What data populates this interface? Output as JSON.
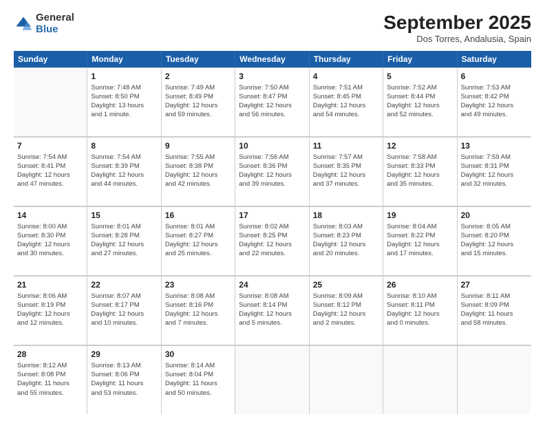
{
  "header": {
    "logo": {
      "general": "General",
      "blue": "Blue"
    },
    "title": "September 2025",
    "subtitle": "Dos Torres, Andalusia, Spain"
  },
  "weekdays": [
    "Sunday",
    "Monday",
    "Tuesday",
    "Wednesday",
    "Thursday",
    "Friday",
    "Saturday"
  ],
  "weeks": [
    [
      {
        "day": "",
        "info": ""
      },
      {
        "day": "1",
        "info": "Sunrise: 7:48 AM\nSunset: 8:50 PM\nDaylight: 13 hours\nand 1 minute."
      },
      {
        "day": "2",
        "info": "Sunrise: 7:49 AM\nSunset: 8:49 PM\nDaylight: 12 hours\nand 59 minutes."
      },
      {
        "day": "3",
        "info": "Sunrise: 7:50 AM\nSunset: 8:47 PM\nDaylight: 12 hours\nand 56 minutes."
      },
      {
        "day": "4",
        "info": "Sunrise: 7:51 AM\nSunset: 8:45 PM\nDaylight: 12 hours\nand 54 minutes."
      },
      {
        "day": "5",
        "info": "Sunrise: 7:52 AM\nSunset: 8:44 PM\nDaylight: 12 hours\nand 52 minutes."
      },
      {
        "day": "6",
        "info": "Sunrise: 7:53 AM\nSunset: 8:42 PM\nDaylight: 12 hours\nand 49 minutes."
      }
    ],
    [
      {
        "day": "7",
        "info": "Sunrise: 7:54 AM\nSunset: 8:41 PM\nDaylight: 12 hours\nand 47 minutes."
      },
      {
        "day": "8",
        "info": "Sunrise: 7:54 AM\nSunset: 8:39 PM\nDaylight: 12 hours\nand 44 minutes."
      },
      {
        "day": "9",
        "info": "Sunrise: 7:55 AM\nSunset: 8:38 PM\nDaylight: 12 hours\nand 42 minutes."
      },
      {
        "day": "10",
        "info": "Sunrise: 7:56 AM\nSunset: 8:36 PM\nDaylight: 12 hours\nand 39 minutes."
      },
      {
        "day": "11",
        "info": "Sunrise: 7:57 AM\nSunset: 8:35 PM\nDaylight: 12 hours\nand 37 minutes."
      },
      {
        "day": "12",
        "info": "Sunrise: 7:58 AM\nSunset: 8:33 PM\nDaylight: 12 hours\nand 35 minutes."
      },
      {
        "day": "13",
        "info": "Sunrise: 7:59 AM\nSunset: 8:31 PM\nDaylight: 12 hours\nand 32 minutes."
      }
    ],
    [
      {
        "day": "14",
        "info": "Sunrise: 8:00 AM\nSunset: 8:30 PM\nDaylight: 12 hours\nand 30 minutes."
      },
      {
        "day": "15",
        "info": "Sunrise: 8:01 AM\nSunset: 8:28 PM\nDaylight: 12 hours\nand 27 minutes."
      },
      {
        "day": "16",
        "info": "Sunrise: 8:01 AM\nSunset: 8:27 PM\nDaylight: 12 hours\nand 25 minutes."
      },
      {
        "day": "17",
        "info": "Sunrise: 8:02 AM\nSunset: 8:25 PM\nDaylight: 12 hours\nand 22 minutes."
      },
      {
        "day": "18",
        "info": "Sunrise: 8:03 AM\nSunset: 8:23 PM\nDaylight: 12 hours\nand 20 minutes."
      },
      {
        "day": "19",
        "info": "Sunrise: 8:04 AM\nSunset: 8:22 PM\nDaylight: 12 hours\nand 17 minutes."
      },
      {
        "day": "20",
        "info": "Sunrise: 8:05 AM\nSunset: 8:20 PM\nDaylight: 12 hours\nand 15 minutes."
      }
    ],
    [
      {
        "day": "21",
        "info": "Sunrise: 8:06 AM\nSunset: 8:19 PM\nDaylight: 12 hours\nand 12 minutes."
      },
      {
        "day": "22",
        "info": "Sunrise: 8:07 AM\nSunset: 8:17 PM\nDaylight: 12 hours\nand 10 minutes."
      },
      {
        "day": "23",
        "info": "Sunrise: 8:08 AM\nSunset: 8:16 PM\nDaylight: 12 hours\nand 7 minutes."
      },
      {
        "day": "24",
        "info": "Sunrise: 8:08 AM\nSunset: 8:14 PM\nDaylight: 12 hours\nand 5 minutes."
      },
      {
        "day": "25",
        "info": "Sunrise: 8:09 AM\nSunset: 8:12 PM\nDaylight: 12 hours\nand 2 minutes."
      },
      {
        "day": "26",
        "info": "Sunrise: 8:10 AM\nSunset: 8:11 PM\nDaylight: 12 hours\nand 0 minutes."
      },
      {
        "day": "27",
        "info": "Sunrise: 8:11 AM\nSunset: 8:09 PM\nDaylight: 11 hours\nand 58 minutes."
      }
    ],
    [
      {
        "day": "28",
        "info": "Sunrise: 8:12 AM\nSunset: 8:08 PM\nDaylight: 11 hours\nand 55 minutes."
      },
      {
        "day": "29",
        "info": "Sunrise: 8:13 AM\nSunset: 8:06 PM\nDaylight: 11 hours\nand 53 minutes."
      },
      {
        "day": "30",
        "info": "Sunrise: 8:14 AM\nSunset: 8:04 PM\nDaylight: 11 hours\nand 50 minutes."
      },
      {
        "day": "",
        "info": ""
      },
      {
        "day": "",
        "info": ""
      },
      {
        "day": "",
        "info": ""
      },
      {
        "day": "",
        "info": ""
      }
    ]
  ]
}
